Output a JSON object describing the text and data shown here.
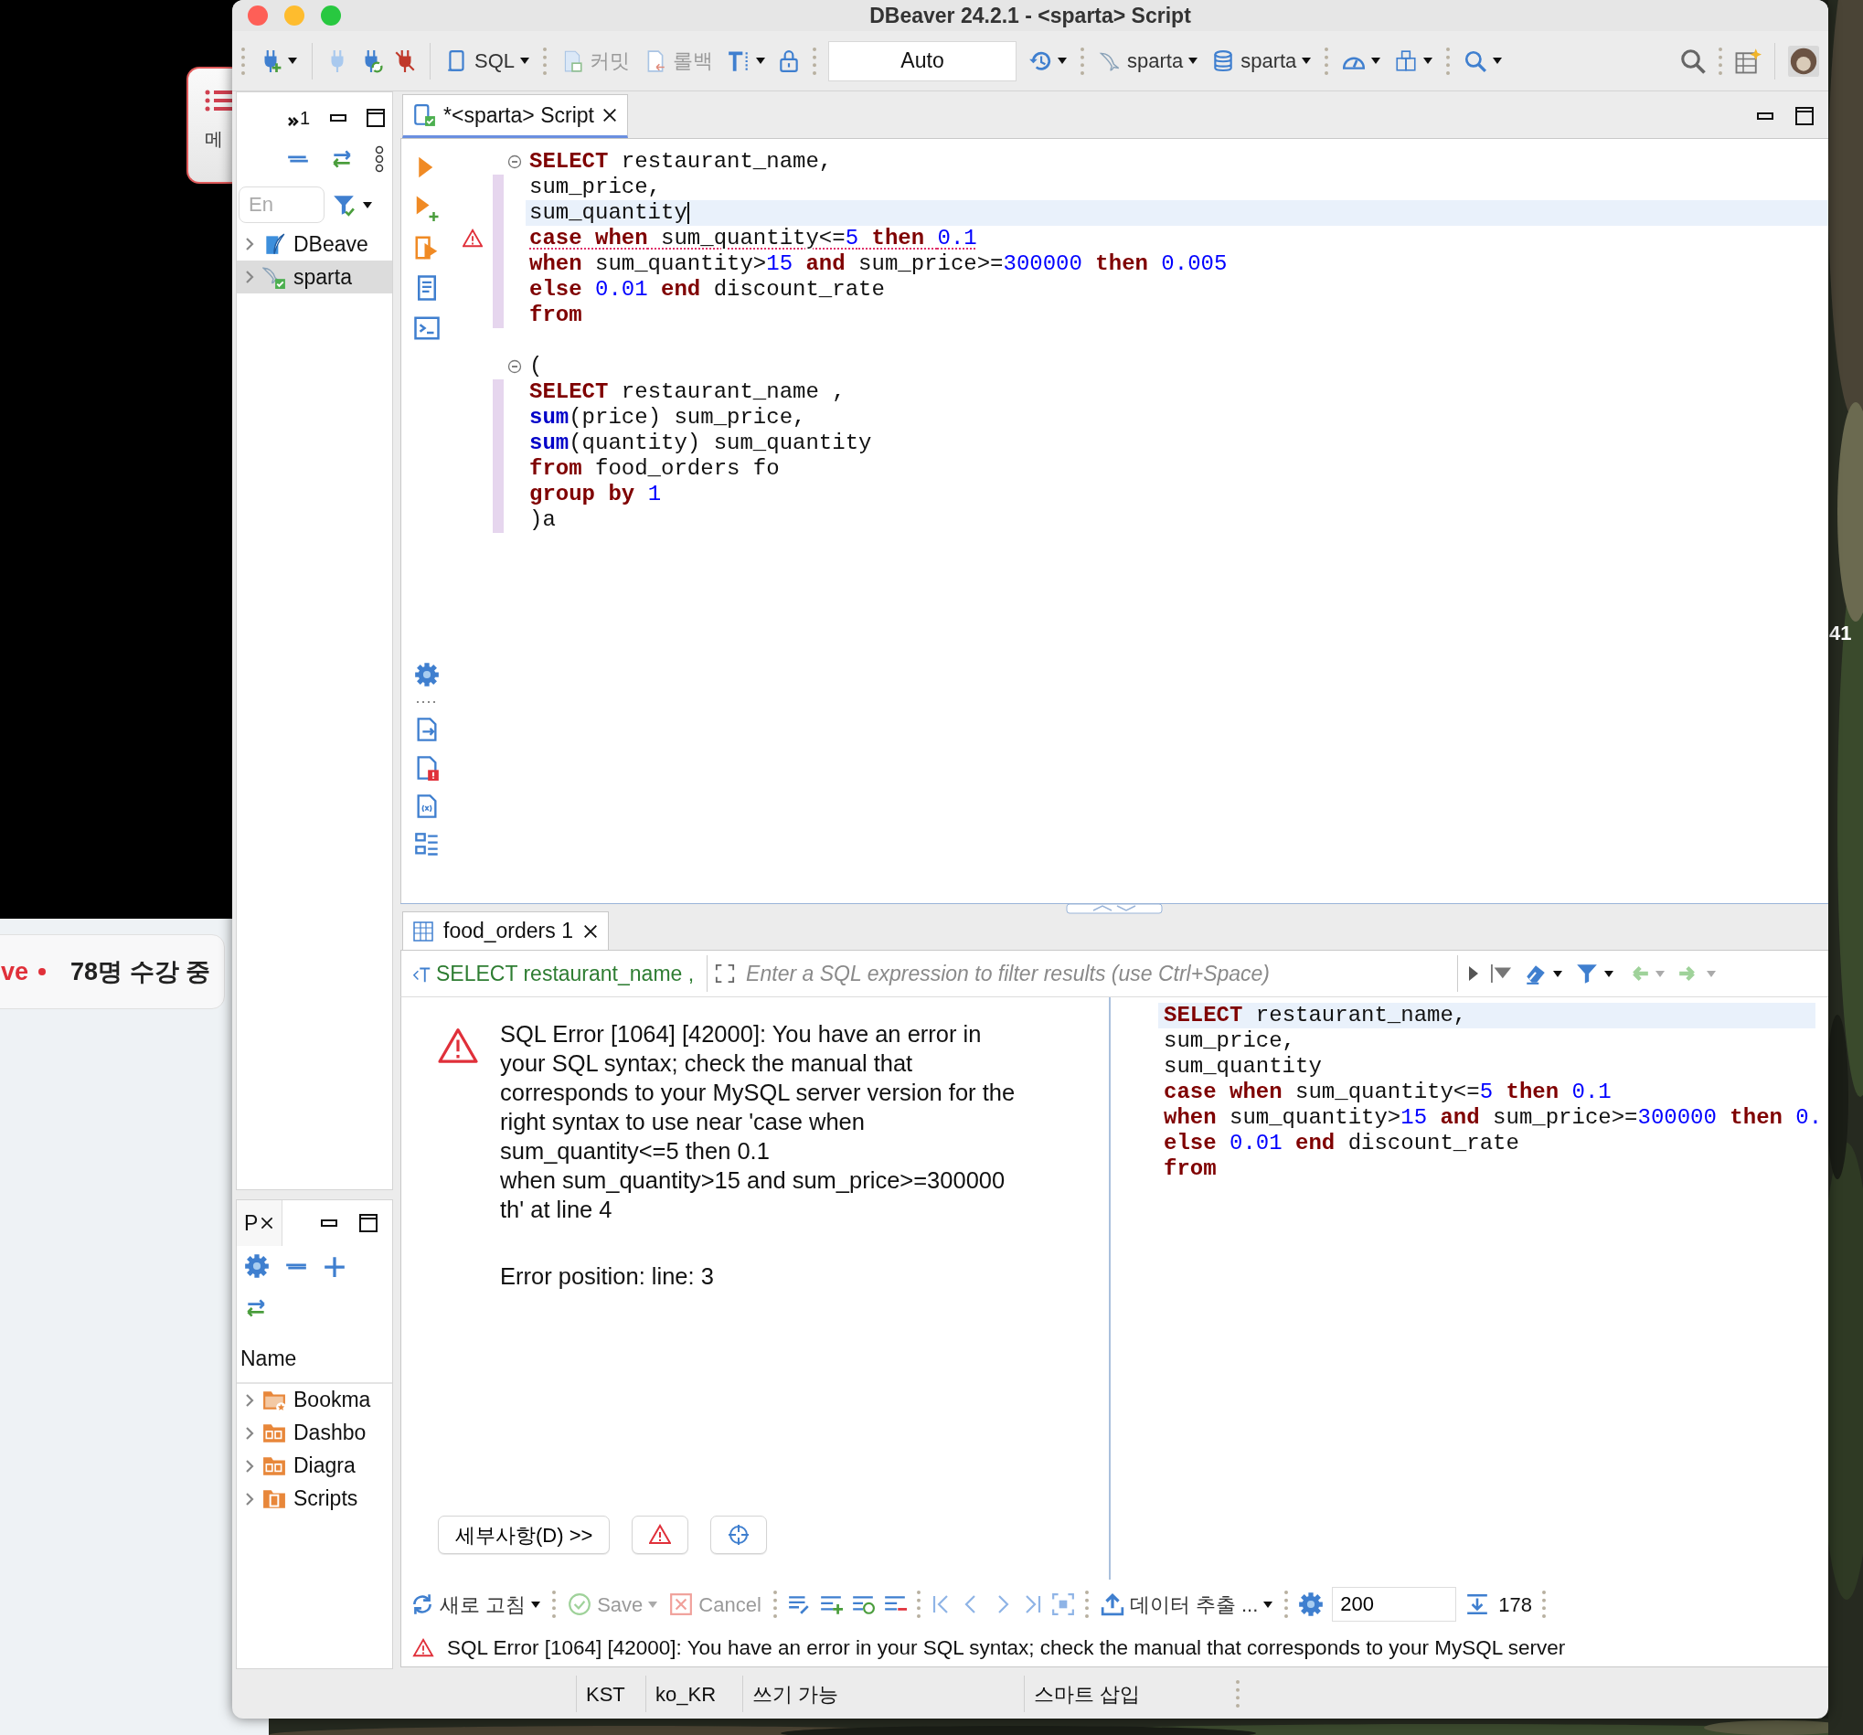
{
  "desktop": {
    "label": "41"
  },
  "browser_page": {
    "menu_label": "메",
    "live_label": "ve",
    "students": "78명 수강 중"
  },
  "window": {
    "title": "DBeaver 24.2.1 - <sparta> Script"
  },
  "toolbar": {
    "sql": {
      "label": "SQL",
      "disabled": false
    },
    "commit": {
      "label": "커밋",
      "disabled": true
    },
    "rollback": {
      "label": "롤백",
      "disabled": true
    },
    "transaction_mode": "Auto",
    "datasource": "sparta",
    "database": "sparta"
  },
  "navigator": {
    "hidden_views": "1",
    "filter_placeholder": "En",
    "items": [
      {
        "label": "DBeave",
        "kind": "dbeaver",
        "selected": false
      },
      {
        "label": "sparta",
        "kind": "mysql",
        "selected": true
      }
    ]
  },
  "projects": {
    "tab": "P",
    "column": "Name",
    "items": [
      {
        "label": "Bookma",
        "kind": "bookmarks"
      },
      {
        "label": "Dashbo",
        "kind": "dashboards"
      },
      {
        "label": "Diagra",
        "kind": "diagrams"
      },
      {
        "label": "Scripts",
        "kind": "scripts"
      }
    ]
  },
  "editor": {
    "tab": "*<sparta> Script",
    "lines": [
      {
        "fold": true,
        "current": false,
        "error": false,
        "s": [
          {
            "kind": "kw",
            "text": "SELECT"
          },
          {
            "kind": "txt",
            "text": " restaurant_name,"
          }
        ]
      },
      {
        "fold": false,
        "current": false,
        "error": false,
        "s": [
          {
            "kind": "txt",
            "text": "sum_price,"
          }
        ]
      },
      {
        "fold": false,
        "current": true,
        "error": false,
        "s": [
          {
            "kind": "txt",
            "text": "sum_quantity"
          }
        ]
      },
      {
        "fold": false,
        "current": false,
        "error": true,
        "s": [
          {
            "kind": "kw",
            "text": "case when"
          },
          {
            "kind": "txt",
            "text": " sum_quantity<="
          },
          {
            "kind": "num",
            "text": "5"
          },
          {
            "kind": "kw",
            "text": " then "
          },
          {
            "kind": "num",
            "text": "0.1"
          }
        ]
      },
      {
        "fold": false,
        "current": false,
        "error": false,
        "s": [
          {
            "kind": "kw",
            "text": "when"
          },
          {
            "kind": "txt",
            "text": " sum_quantity>"
          },
          {
            "kind": "num",
            "text": "15"
          },
          {
            "kind": "kw",
            "text": " and"
          },
          {
            "kind": "txt",
            "text": " sum_price>="
          },
          {
            "kind": "num",
            "text": "300000"
          },
          {
            "kind": "kw",
            "text": " then "
          },
          {
            "kind": "num",
            "text": "0.005"
          }
        ]
      },
      {
        "fold": false,
        "current": false,
        "error": false,
        "s": [
          {
            "kind": "kw",
            "text": "else "
          },
          {
            "kind": "num",
            "text": "0.01"
          },
          {
            "kind": "kw",
            "text": " end"
          },
          {
            "kind": "txt",
            "text": " discount_rate"
          }
        ]
      },
      {
        "fold": false,
        "current": false,
        "error": false,
        "s": [
          {
            "kind": "kw",
            "text": "from"
          }
        ]
      },
      {
        "fold": true,
        "current": false,
        "error": false,
        "s": [
          {
            "kind": "txt",
            "text": "("
          }
        ]
      },
      {
        "fold": false,
        "current": false,
        "error": false,
        "s": [
          {
            "kind": "kw",
            "text": "SELECT"
          },
          {
            "kind": "txt",
            "text": " restaurant_name ,"
          }
        ]
      },
      {
        "fold": false,
        "current": false,
        "error": false,
        "s": [
          {
            "kind": "fn",
            "text": "sum"
          },
          {
            "kind": "txt",
            "text": "(price) sum_price,"
          }
        ]
      },
      {
        "fold": false,
        "current": false,
        "error": false,
        "s": [
          {
            "kind": "fn",
            "text": "sum"
          },
          {
            "kind": "txt",
            "text": "(quantity) sum_quantity"
          }
        ]
      },
      {
        "fold": false,
        "current": false,
        "error": false,
        "s": [
          {
            "kind": "kw",
            "text": "from"
          },
          {
            "kind": "txt",
            "text": " food_orders fo"
          }
        ]
      },
      {
        "fold": false,
        "current": false,
        "error": false,
        "s": [
          {
            "kind": "kw",
            "text": "group by "
          },
          {
            "kind": "num",
            "text": "1"
          }
        ]
      },
      {
        "fold": false,
        "current": false,
        "error": false,
        "s": [
          {
            "kind": "txt",
            "text": ")a"
          }
        ]
      }
    ]
  },
  "results": {
    "tab": "food_orders 1",
    "query": "SELECT restaurant_name ,",
    "filter_placeholder": "Enter a SQL expression to filter results (use Ctrl+Space)",
    "error_message": [
      "SQL Error [1064] [42000]: You have an error in",
      "your SQL syntax; check the manual that",
      "corresponds to your MySQL server version for the",
      "right syntax to use near 'case when",
      "sum_quantity<=5 then 0.1",
      "when sum_quantity>15 and sum_price>=300000",
      "th' at line 4"
    ],
    "error_position": "Error position: line: 3",
    "details_button": "세부사항(D) >>",
    "query_lines": [
      {
        "current": true,
        "s": [
          {
            "kind": "kw",
            "text": "SELECT"
          },
          {
            "kind": "txt",
            "text": " restaurant_name,"
          }
        ]
      },
      {
        "current": false,
        "s": [
          {
            "kind": "txt",
            "text": "sum_price,"
          }
        ]
      },
      {
        "current": false,
        "s": [
          {
            "kind": "txt",
            "text": "sum_quantity"
          }
        ]
      },
      {
        "current": false,
        "s": [
          {
            "kind": "kw",
            "text": "case when"
          },
          {
            "kind": "txt",
            "text": " sum_quantity<="
          },
          {
            "kind": "num",
            "text": "5"
          },
          {
            "kind": "kw",
            "text": " then "
          },
          {
            "kind": "num",
            "text": "0.1"
          }
        ]
      },
      {
        "current": false,
        "s": [
          {
            "kind": "kw",
            "text": "when"
          },
          {
            "kind": "txt",
            "text": " sum_quantity>"
          },
          {
            "kind": "num",
            "text": "15"
          },
          {
            "kind": "kw",
            "text": " and"
          },
          {
            "kind": "txt",
            "text": " sum_price>="
          },
          {
            "kind": "num",
            "text": "300000"
          },
          {
            "kind": "kw",
            "text": " then "
          },
          {
            "kind": "num",
            "text": "0."
          }
        ]
      },
      {
        "current": false,
        "s": [
          {
            "kind": "kw",
            "text": "else "
          },
          {
            "kind": "num",
            "text": "0.01"
          },
          {
            "kind": "kw",
            "text": " end"
          },
          {
            "kind": "txt",
            "text": " discount_rate"
          }
        ]
      },
      {
        "current": false,
        "s": [
          {
            "kind": "kw",
            "text": "from"
          }
        ]
      }
    ],
    "refresh": "새로 고침",
    "save": {
      "label": "Save",
      "disabled": true
    },
    "cancel": {
      "label": "Cancel",
      "disabled": true
    },
    "export": "데이터 추출 ...",
    "fetch_size": "200",
    "row_count": "178",
    "status_message": "SQL Error [1064] [42000]: You have an error in your SQL syntax; check the manual that corresponds to your MySQL server"
  },
  "status_bar": [
    "KST",
    "ko_KR",
    "쓰기 가능",
    "스마트 삽입"
  ]
}
